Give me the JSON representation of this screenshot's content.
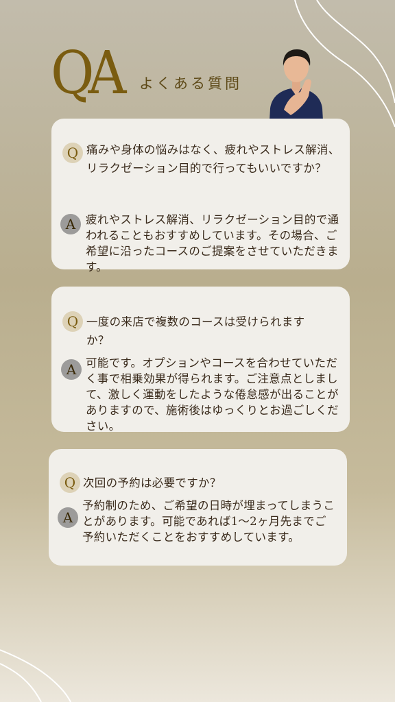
{
  "header": {
    "logo": "QA",
    "subtitle": "よくある質問"
  },
  "qa": [
    {
      "q_badge": "Q",
      "question": "痛みや身体の悩みはなく、疲れやストレス解消、リラクゼーション目的で行ってもいいですか？",
      "a_badge": "A",
      "answer": "疲れやストレス解消、リラクゼーション目的で通われることもおすすめしています。その場合、ご希望に沿ったコースのご提案をさせていただきます。"
    },
    {
      "q_badge": "Q",
      "question": "一度の来店で複数のコースは受けられますか？",
      "a_badge": "A",
      "answer": "可能です。オプションやコースを合わせていただく事で相乗効果が得られます。ご注意点としまして、激しく運動をしたような倦怠感が出ることがありますので、施術後はゆっくりとお過ごしください。"
    },
    {
      "q_badge": "Q",
      "question": "次回の予約は必要ですか？",
      "a_badge": "A",
      "answer": "予約制のため、ご希望の日時が埋まってしまうことがあります。可能であれば1〜2ヶ月先までご予約いただくことをおすすめしています。"
    }
  ]
}
